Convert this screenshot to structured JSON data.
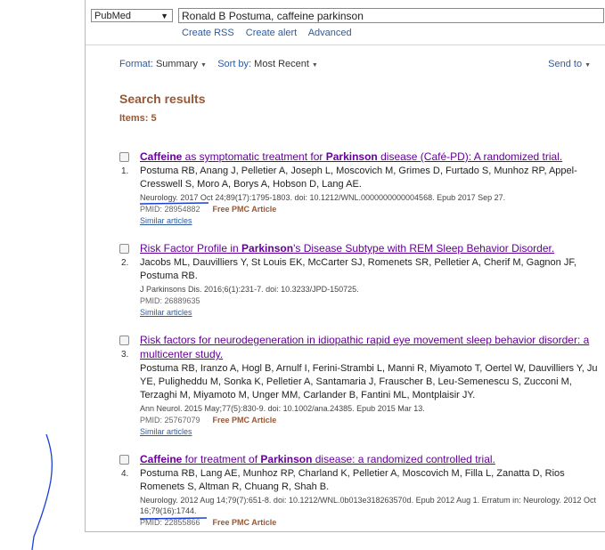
{
  "search": {
    "database": "PubMed",
    "query": "Ronald B Postuma, caffeine parkinson",
    "links": [
      "Create RSS",
      "Create alert",
      "Advanced"
    ]
  },
  "options": {
    "format_label": "Format:",
    "format_value": "Summary",
    "sort_label": "Sort by:",
    "sort_value": "Most Recent",
    "send_to": "Send to"
  },
  "results": {
    "heading": "Search results",
    "count_label": "Items: 5",
    "items": [
      {
        "number": "1.",
        "title_parts": [
          {
            "t": "Caffeine",
            "b": true
          },
          {
            "t": " as symptomatic treatment for ",
            "b": false
          },
          {
            "t": "Parkinson",
            "b": true
          },
          {
            "t": " disease (Café-PD): A randomized trial.",
            "b": false
          }
        ],
        "authors": "Postuma RB, Anang J, Pelletier A, Joseph L, Moscovich M, Grimes D, Furtado S, Munhoz RP, Appel-Cresswell S, Moro A, Borys A, Hobson D, Lang AE.",
        "citation": "Neurology. 2017 Oct 24;89(17):1795-1803. doi: 10.1212/WNL.0000000000004568. Epub 2017 Sep 27.",
        "pmid": "PMID: 28954882",
        "pmc": "Free PMC Article",
        "similar": "Similar articles"
      },
      {
        "number": "2.",
        "title_parts": [
          {
            "t": "Risk Factor Profile in ",
            "b": false
          },
          {
            "t": "Parkinson",
            "b": true
          },
          {
            "t": "'s Disease Subtype with REM Sleep Behavior Disorder.",
            "b": false
          }
        ],
        "authors": "Jacobs ML, Dauvilliers Y, St Louis EK, McCarter SJ, Romenets SR, Pelletier A, Cherif M, Gagnon JF, Postuma RB.",
        "citation": "J Parkinsons Dis. 2016;6(1):231-7. doi: 10.3233/JPD-150725.",
        "pmid": "PMID: 26889635",
        "pmc": "",
        "similar": "Similar articles"
      },
      {
        "number": "3.",
        "title_parts": [
          {
            "t": "Risk factors for neurodegeneration in idiopathic rapid eye movement sleep behavior disorder: a multicenter study.",
            "b": false
          }
        ],
        "authors": "Postuma RB, Iranzo A, Hogl B, Arnulf I, Ferini-Strambi L, Manni R, Miyamoto T, Oertel W, Dauvilliers Y, Ju YE, Puligheddu M, Sonka K, Pelletier A, Santamaria J, Frauscher B, Leu-Semenescu S, Zucconi M, Terzaghi M, Miyamoto M, Unger MM, Carlander B, Fantini ML, Montplaisir JY.",
        "citation": "Ann Neurol. 2015 May;77(5):830-9. doi: 10.1002/ana.24385. Epub 2015 Mar 13.",
        "pmid": "PMID: 25767079",
        "pmc": "Free PMC Article",
        "similar": "Similar articles"
      },
      {
        "number": "4.",
        "title_parts": [
          {
            "t": "Caffeine",
            "b": true
          },
          {
            "t": " for treatment of ",
            "b": false
          },
          {
            "t": "Parkinson",
            "b": true
          },
          {
            "t": " disease: a randomized controlled trial.",
            "b": false
          }
        ],
        "authors": "Postuma RB, Lang AE, Munhoz RP, Charland K, Pelletier A, Moscovich M, Filla L, Zanatta D, Rios Romenets S, Altman R, Chuang R, Shah B.",
        "citation": "Neurology. 2012 Aug 14;79(7):651-8. doi: 10.1212/WNL.0b013e318263570d. Epub 2012 Aug 1. Erratum in: Neurology. 2012 Oct 16;79(16):1744.",
        "pmid": "PMID: 22855866",
        "pmc": "Free PMC Article",
        "similar": ""
      }
    ]
  },
  "colors": {
    "title_link": "#660099",
    "accent_brown": "#985735",
    "link_blue": "#2f5b9c",
    "annotation_ink": "#1a3fd6"
  }
}
